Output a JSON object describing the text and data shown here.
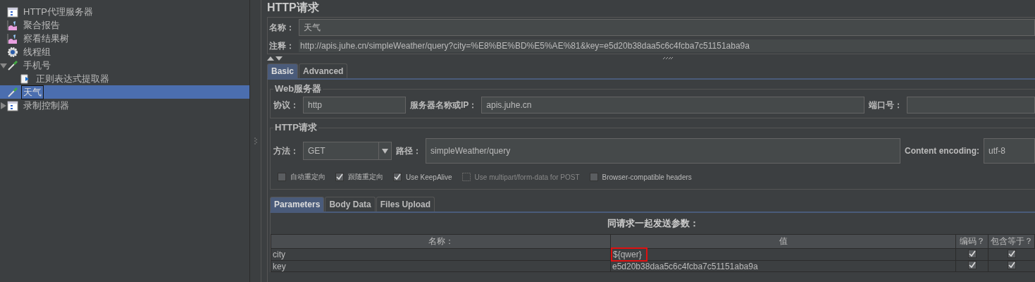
{
  "tree": [
    {
      "label": "HTTP代理服务器",
      "kind": "proxy",
      "selected": false
    },
    {
      "label": "聚合报告",
      "kind": "report",
      "selected": false
    },
    {
      "label": "察看结果树",
      "kind": "report",
      "selected": false
    },
    {
      "label": "线程组",
      "kind": "gear",
      "selected": false
    },
    {
      "label": "手机号",
      "kind": "sampler",
      "selected": false,
      "expanded": true,
      "children": [
        {
          "label": "正则表达式提取器",
          "kind": "extractor",
          "selected": false
        }
      ]
    },
    {
      "label": "天气",
      "kind": "sampler",
      "selected": true
    },
    {
      "label": "录制控制器",
      "kind": "controller",
      "selected": false,
      "expanded": false
    }
  ],
  "editor": {
    "title": "HTTP请求",
    "name_label": "名称：",
    "name_value": "天气",
    "comment_label": "注释：",
    "comment_value": "http://apis.juhe.cn/simpleWeather/query?city=%E8%BE%BD%E5%AE%81&key=e5d20b38daa5c6c4fcba7c51151aba9a",
    "tabs": [
      {
        "label": "Basic",
        "selected": true
      },
      {
        "label": "Advanced",
        "selected": false
      }
    ],
    "web_server": {
      "legend": "Web服务器",
      "protocol_label": "协议：",
      "protocol": "http",
      "server_label": "服务器名称或IP：",
      "server": "apis.juhe.cn",
      "port_label": "端口号："
    },
    "http_request": {
      "legend": "HTTP请求",
      "method_label": "方法：",
      "method": "GET",
      "path_label": "路径：",
      "path": "simpleWeather/query",
      "encoding_label": "Content encoding:",
      "encoding": "utf-8",
      "options": [
        {
          "label": "自动重定向",
          "checked": false,
          "disabled": false
        },
        {
          "label": "跟随重定向",
          "checked": true,
          "disabled": false
        },
        {
          "label": "Use KeepAlive",
          "checked": true,
          "disabled": false
        },
        {
          "label": "Use multipart/form-data for POST",
          "checked": false,
          "disabled": true
        },
        {
          "label": "Browser-compatible headers",
          "checked": false,
          "disabled": false
        }
      ]
    },
    "param_tabs": [
      {
        "label": "Parameters",
        "selected": true
      },
      {
        "label": "Body Data",
        "selected": false
      },
      {
        "label": "Files Upload",
        "selected": false
      }
    ],
    "table_title": "同请求一起发送参数：",
    "columns": [
      "名称：",
      "值",
      "编码？",
      "包含等于？"
    ],
    "rows": [
      {
        "name": "city",
        "value": "${qwer}",
        "highlighted": true,
        "encode": true,
        "include_equals": true
      },
      {
        "name": "key",
        "value": "e5d20b38daa5c6c4fcba7c51151aba9a",
        "highlighted": false,
        "encode": true,
        "include_equals": true
      }
    ]
  }
}
